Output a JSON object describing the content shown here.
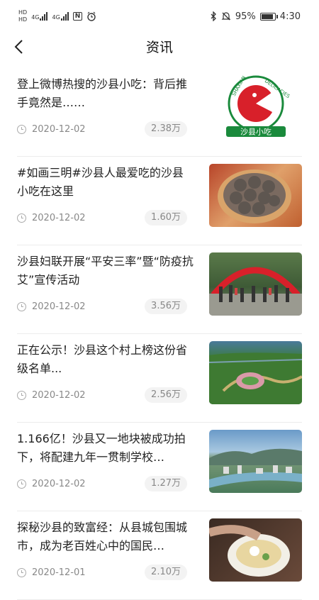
{
  "status_bar": {
    "left_labels": [
      "HD",
      "4G",
      "HD",
      "4G",
      "N"
    ],
    "battery_percent": "95%",
    "battery_level": 0.95,
    "time": "4:30"
  },
  "header": {
    "title": "资讯"
  },
  "news": [
    {
      "title": "登上微博热搜的沙县小吃：背后推手竟然是……",
      "date": "2020-12-02",
      "views": "2.38万",
      "logo_text_top": "SHAXIAN",
      "logo_text_right": "DELICACIES",
      "logo_banner": "沙县小吃"
    },
    {
      "title": "#如画三明#沙县人最爱吃的沙县小吃在这里",
      "date": "2020-12-02",
      "views": "1.60万"
    },
    {
      "title": "沙县妇联开展“平安三率”暨“防疫抗艾”宣传活动",
      "date": "2020-12-02",
      "views": "3.56万"
    },
    {
      "title": "正在公示！沙县这个村上榜这份省级名单...",
      "date": "2020-12-02",
      "views": "2.56万"
    },
    {
      "title": "1.166亿！沙县又一地块被成功拍下，将配建九年一贯制学校…",
      "date": "2020-12-02",
      "views": "1.27万"
    },
    {
      "title": "探秘沙县的致富经：从县城包围城市，成为老百姓心中的国民…",
      "date": "2020-12-01",
      "views": "2.10万"
    }
  ]
}
